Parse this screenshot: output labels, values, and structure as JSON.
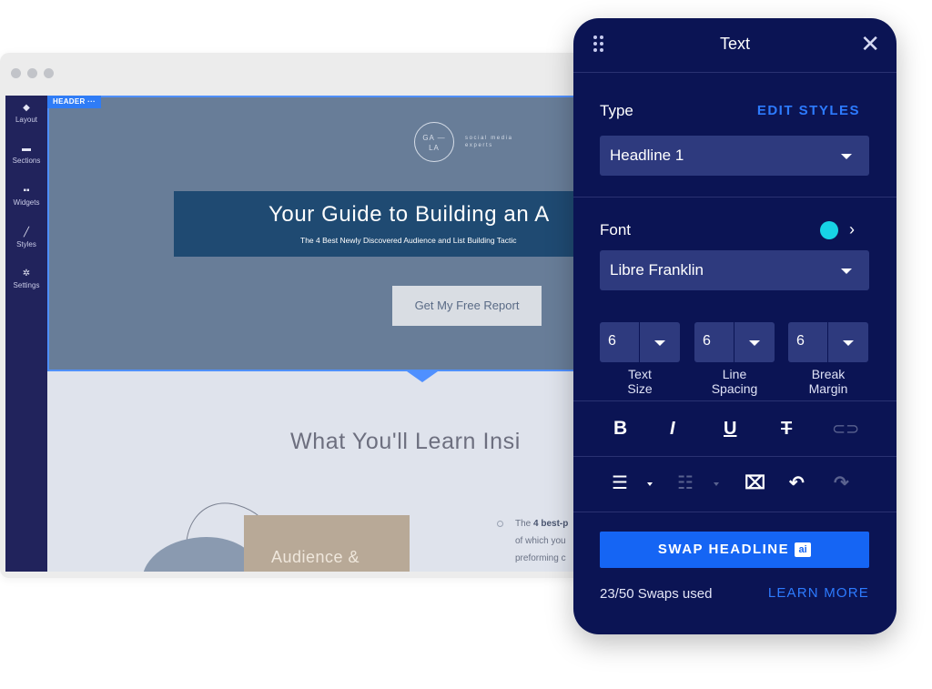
{
  "browser": {
    "window_dots": [
      "",
      "",
      ""
    ]
  },
  "sidebar": {
    "items": [
      {
        "label": "Layout",
        "icon": "layers-icon"
      },
      {
        "label": "Sections",
        "icon": "sections-icon"
      },
      {
        "label": "Widgets",
        "icon": "widgets-icon"
      },
      {
        "label": "Styles",
        "icon": "brush-icon"
      },
      {
        "label": "Settings",
        "icon": "gear-icon"
      }
    ]
  },
  "page": {
    "section_tag": "HEADER",
    "section_tag_more": "···",
    "logo_mark_top": "GA —",
    "logo_mark_bottom": "LA",
    "logo_tagline_1": "social media",
    "logo_tagline_2": "experts",
    "hero_title": "Your Guide to Building an A",
    "hero_subtitle": "The 4 Best Newly Discovered Audience and List Building Tactic",
    "cta_label": "Get My Free Report",
    "learn_title": "What You'll Learn Insi",
    "book_text": "Audience &",
    "bullet_bold": "4 best-p",
    "bullet_prefix": "The ",
    "bullet_line_2": "of which you",
    "bullet_line_3": "preforming c",
    "colors": {
      "header_bg": "#687d98",
      "selection": "#4f90ff",
      "band": "#1f4a72"
    }
  },
  "panel": {
    "title": "Text",
    "type_label": "Type",
    "edit_styles": "EDIT STYLES",
    "type_value": "Headline 1",
    "font_label": "Font",
    "font_color": "#17d3e6",
    "font_value": "Libre Franklin",
    "text_size": {
      "value": "6",
      "label_1": "Text",
      "label_2": "Size"
    },
    "line_spacing": {
      "value": "6",
      "label_1": "Line",
      "label_2": "Spacing"
    },
    "break_margin": {
      "value": "6",
      "label_1": "Break",
      "label_2": "Margin"
    },
    "format": {
      "bold": "B",
      "italic": "I",
      "underline": "U",
      "strike": "T̶",
      "link": "⊂⊃"
    },
    "swap_label": "SWAP HEADLINE",
    "ai_badge": "ai",
    "swaps_used": "23/50 Swaps used",
    "learn_more": "LEARN MORE",
    "colors": {
      "bg": "#0b1454",
      "accent": "#2d7bff",
      "button": "#1565f4"
    }
  }
}
